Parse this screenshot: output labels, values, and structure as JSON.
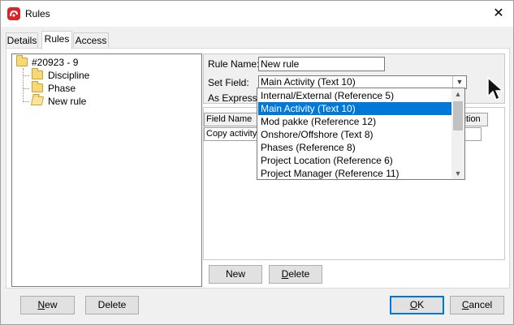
{
  "window": {
    "title": "Rules",
    "close_glyph": "✕",
    "app_icon": "app-logo-icon"
  },
  "tabs": [
    {
      "label": "Details",
      "active": false
    },
    {
      "label": "Rules",
      "active": true
    },
    {
      "label": "Access",
      "active": false
    }
  ],
  "tree": {
    "root": "#20923 - 9",
    "children": [
      "Discipline",
      "Phase",
      "New rule"
    ]
  },
  "form": {
    "rule_name_label": "Rule Name:",
    "rule_name_value": "New rule",
    "set_field_label": "Set Field:",
    "set_field_value": "Main Activity (Text 10)",
    "as_expression_label": "As Expression"
  },
  "grid": {
    "headers": [
      "Field Name",
      "sition"
    ],
    "row_first_cell": "Copy activity"
  },
  "inner_buttons": {
    "new": "New",
    "delete": "Delete"
  },
  "dropdown": {
    "items": [
      "Internal/External (Reference 5)",
      "Main Activity (Text 10)",
      "Mod pakke (Reference 12)",
      "Onshore/Offshore (Text 8)",
      "Phases (Reference 8)",
      "Project Location (Reference 6)",
      "Project Manager (Reference 11)"
    ],
    "selected_index": 1,
    "selected_color": "#0078d7"
  },
  "footer": {
    "new": "New",
    "delete": "Delete",
    "ok": "OK",
    "cancel": "Cancel"
  }
}
